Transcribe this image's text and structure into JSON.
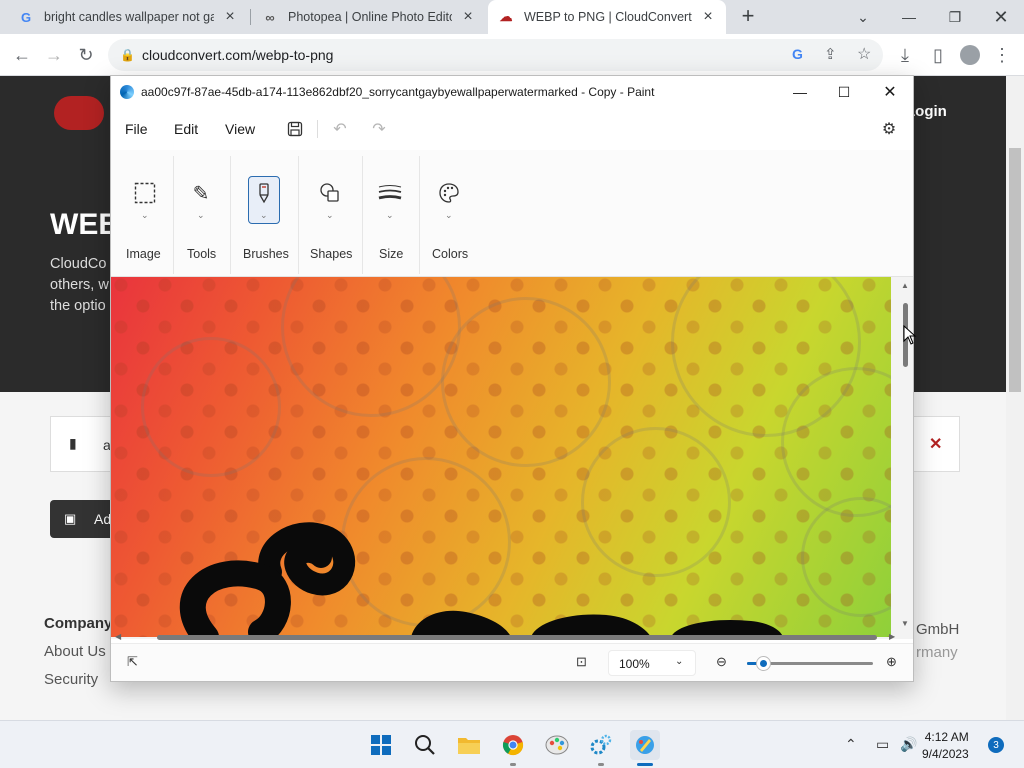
{
  "browser": {
    "tabs": [
      {
        "title": "bright candles wallpaper not gay",
        "favicon": "G"
      },
      {
        "title": "Photopea | Online Photo Editor",
        "favicon": "∞"
      },
      {
        "title": "WEBP to PNG | CloudConvert",
        "favicon": "☁"
      }
    ],
    "url": "cloudconvert.com/webp-to-png",
    "icons": [
      "back-icon",
      "forward-icon",
      "reload-icon",
      "lock-icon",
      "google-icon",
      "share-icon",
      "star-icon",
      "download-icon",
      "sidepanel-icon",
      "profile-icon",
      "menu-icon"
    ]
  },
  "page": {
    "login": "Login",
    "hero_title": "WEB",
    "hero_desc_1": "CloudCo",
    "hero_desc_2": "others, w",
    "hero_desc_3": "the optio",
    "file_name": "a",
    "add_btn": "Ad",
    "footer_heading": "Company",
    "footer_link_1": "About Us",
    "footer_link_2": "Security",
    "footer_right_1": "GmbH",
    "footer_right_2": "rmany"
  },
  "paint": {
    "title": "aa00c97f-87ae-45db-a174-113e862dbf20_sorrycantgaybyewallpaperwatermarked - Copy - Paint",
    "menus": [
      "File",
      "Edit",
      "View"
    ],
    "ribbon": [
      {
        "label": "Image",
        "icon": "selection-icon"
      },
      {
        "label": "Tools",
        "icon": "tools-icon"
      },
      {
        "label": "Brushes",
        "icon": "brush-icon"
      },
      {
        "label": "Shapes",
        "icon": "shapes-icon"
      },
      {
        "label": "Size",
        "icon": "size-icon"
      },
      {
        "label": "Colors",
        "icon": "palette-icon"
      }
    ],
    "zoom": "100%",
    "zoom_slider_fraction": 0.13
  },
  "taskbar": {
    "time": "4:12 AM",
    "date": "9/4/2023",
    "notifications": "3"
  }
}
